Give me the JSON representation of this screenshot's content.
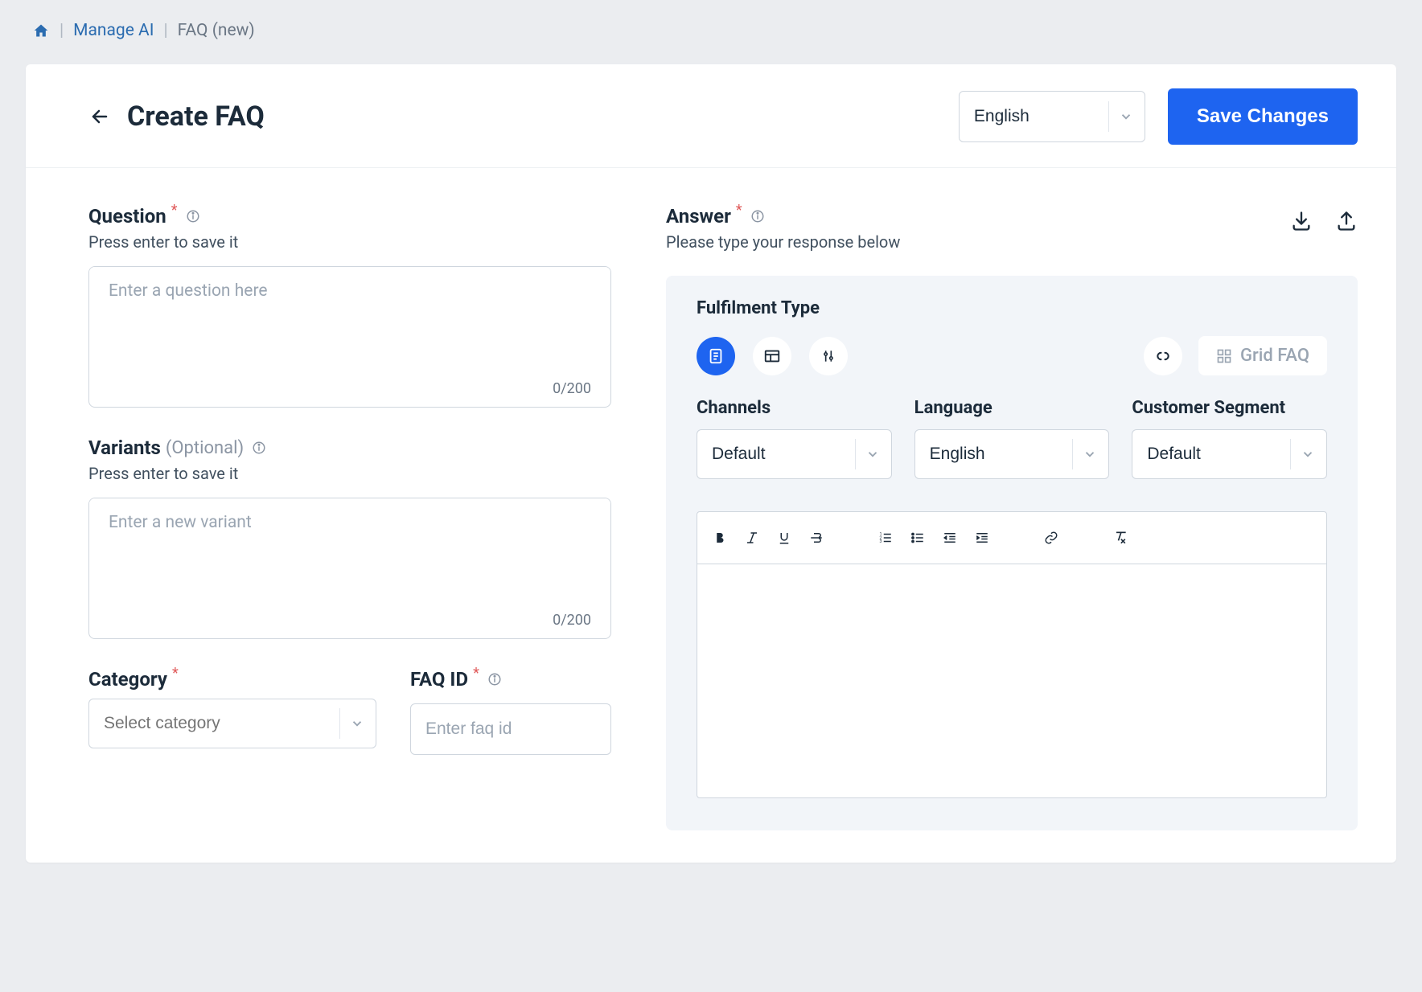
{
  "breadcrumb": {
    "manage": "Manage AI",
    "current": "FAQ (new)"
  },
  "header": {
    "title": "Create FAQ",
    "language": "English",
    "save": "Save Changes"
  },
  "question": {
    "label": "Question",
    "sub": "Press enter to save it",
    "placeholder": "Enter a question here",
    "counter": "0/200"
  },
  "variants": {
    "label": "Variants",
    "optional": "(Optional)",
    "sub": "Press enter to save it",
    "placeholder": "Enter a new variant",
    "counter": "0/200"
  },
  "category": {
    "label": "Category",
    "placeholder": "Select category"
  },
  "faqid": {
    "label": "FAQ ID",
    "placeholder": "Enter faq id"
  },
  "answer": {
    "label": "Answer",
    "sub": "Please type your response below",
    "fulfilment": "Fulfilment Type",
    "gridfaq": "Grid FAQ",
    "channels": {
      "label": "Channels",
      "value": "Default"
    },
    "language": {
      "label": "Language",
      "value": "English"
    },
    "segment": {
      "label": "Customer Segment",
      "value": "Default"
    }
  }
}
